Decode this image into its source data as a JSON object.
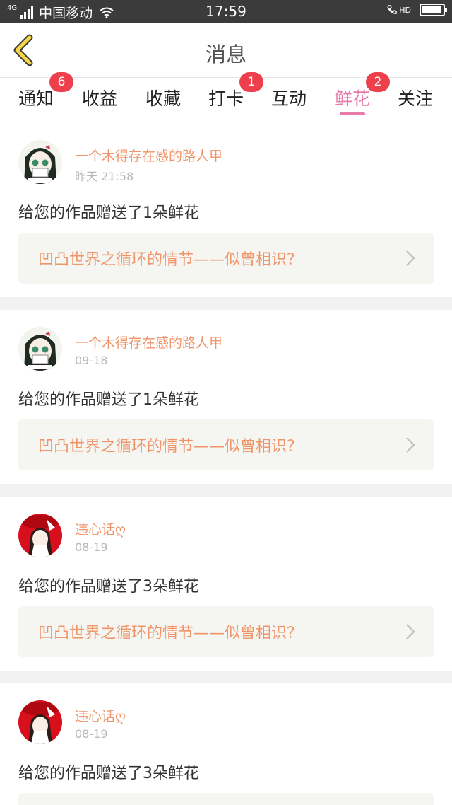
{
  "status_bar": {
    "network_type": "4G",
    "carrier": "中国移动",
    "time": "17:59",
    "hd_label": "HD"
  },
  "header": {
    "title": "消息",
    "back_icon": "chevron-left-icon"
  },
  "tabs": [
    {
      "label": "通知",
      "badge": "6"
    },
    {
      "label": "收益",
      "badge": ""
    },
    {
      "label": "收藏",
      "badge": ""
    },
    {
      "label": "打卡",
      "badge": "1"
    },
    {
      "label": "互动",
      "badge": ""
    },
    {
      "label": "鲜花",
      "badge": "2",
      "active": true
    },
    {
      "label": "关注",
      "badge": ""
    }
  ],
  "colors": {
    "accent_pink": "#e87ca8",
    "name_orange": "#f0956a",
    "badge_red": "#ee3f4d"
  },
  "messages": [
    {
      "user": "一个木得存在感的路人甲",
      "time": "昨天 21:58",
      "text": "给您的作品赠送了1朵鲜花",
      "work": "凹凸世界之循环的情节——似曾相识？"
    },
    {
      "user": "一个木得存在感的路人甲",
      "time": "09-18",
      "text": "给您的作品赠送了1朵鲜花",
      "work": "凹凸世界之循环的情节——似曾相识？"
    },
    {
      "user": "违心话ღ",
      "time": "08-19",
      "text": "给您的作品赠送了3朵鲜花",
      "work": "凹凸世界之循环的情节——似曾相识？"
    },
    {
      "user": "违心话ღ",
      "time": "08-19",
      "text": "给您的作品赠送了3朵鲜花",
      "work": ""
    }
  ]
}
